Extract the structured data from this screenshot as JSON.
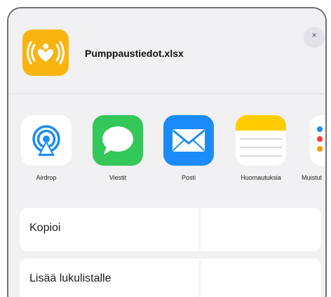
{
  "header": {
    "filename": "Pumppaustiedot.xlsx",
    "file_icon": "heart-signal-icon",
    "close_label": "×"
  },
  "share_apps": [
    {
      "label": "Airdrop",
      "icon": "airdrop-icon"
    },
    {
      "label": "Viestit",
      "icon": "messages-icon"
    },
    {
      "label": "Posti",
      "icon": "mail-icon"
    },
    {
      "label": "Huomautuksia",
      "icon": "notes-icon"
    },
    {
      "label": "Muistut",
      "icon": "reminders-icon"
    }
  ],
  "actions": [
    {
      "label": "Kopioi"
    },
    {
      "label": "Lisää lukulistalle"
    }
  ],
  "colors": {
    "file_icon_bg": "#f9b40f",
    "messages": "#34c759",
    "mail": "#1b8cf7",
    "notes": "#ffcc00",
    "airdrop": "#1b8cf7"
  }
}
